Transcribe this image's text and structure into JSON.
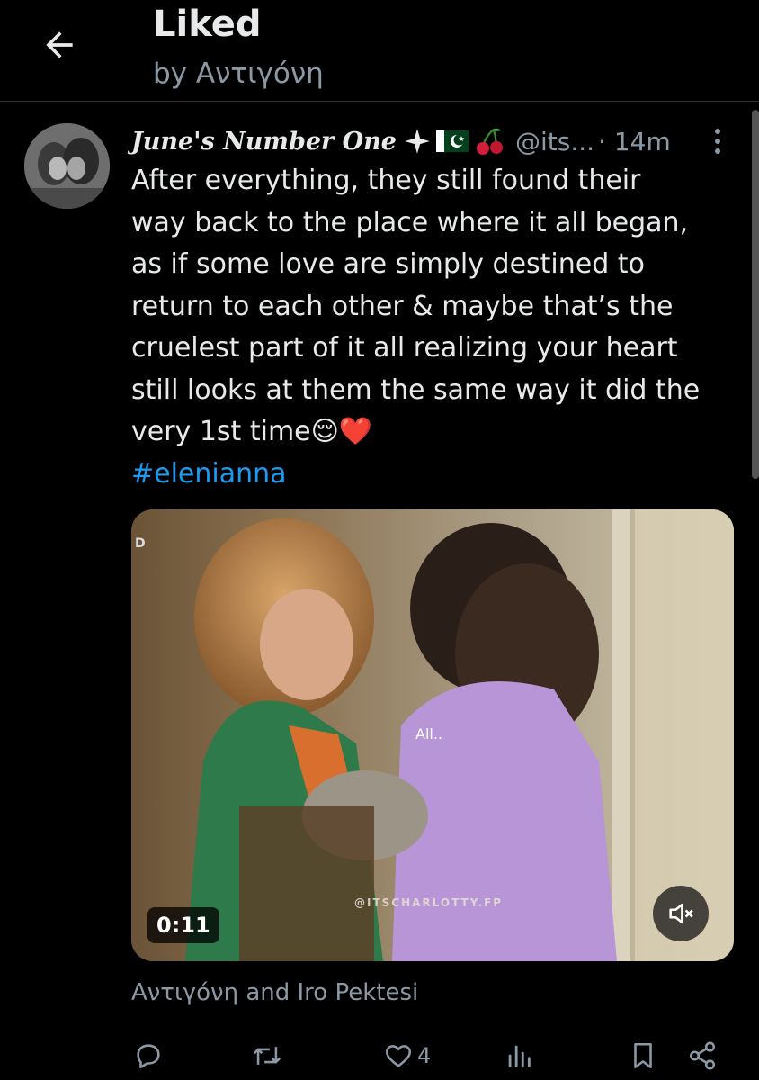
{
  "header": {
    "title": "Liked",
    "subtitle": "by Αντιγόνη"
  },
  "tweet": {
    "author": {
      "display_name": "June's Number One",
      "emoji_icons": [
        "sparkle-icon",
        "pakistan-flag-icon",
        "cherries-icon"
      ],
      "handle": "@its...",
      "timestamp": "· 14m"
    },
    "text_lines": [
      "After everything, they still found their",
      "way back to the place where it all began,",
      "as if some love are simply destined to",
      "return to each other & maybe that’s the",
      "cruelest part of it all realizing your heart",
      "still looks at them the same way it did the",
      "very 1st time😌❤️"
    ],
    "hashtag": "#elenianna",
    "media": {
      "duration": "0:11",
      "caption": "All..",
      "watermark": "@ITSCHARLOTTY.FP",
      "corner_mark": "D",
      "muted": true
    },
    "social_context": "Αντιγόνη and Iro Pektesi",
    "actions": {
      "reply_count": "",
      "repost_count": "",
      "like_count": "4",
      "views_count": ""
    }
  },
  "colors": {
    "background": "#000000",
    "text": "#e7e9ea",
    "muted": "#8b98a5",
    "link": "#1d9bf0",
    "like_heart": "#e0245e"
  }
}
